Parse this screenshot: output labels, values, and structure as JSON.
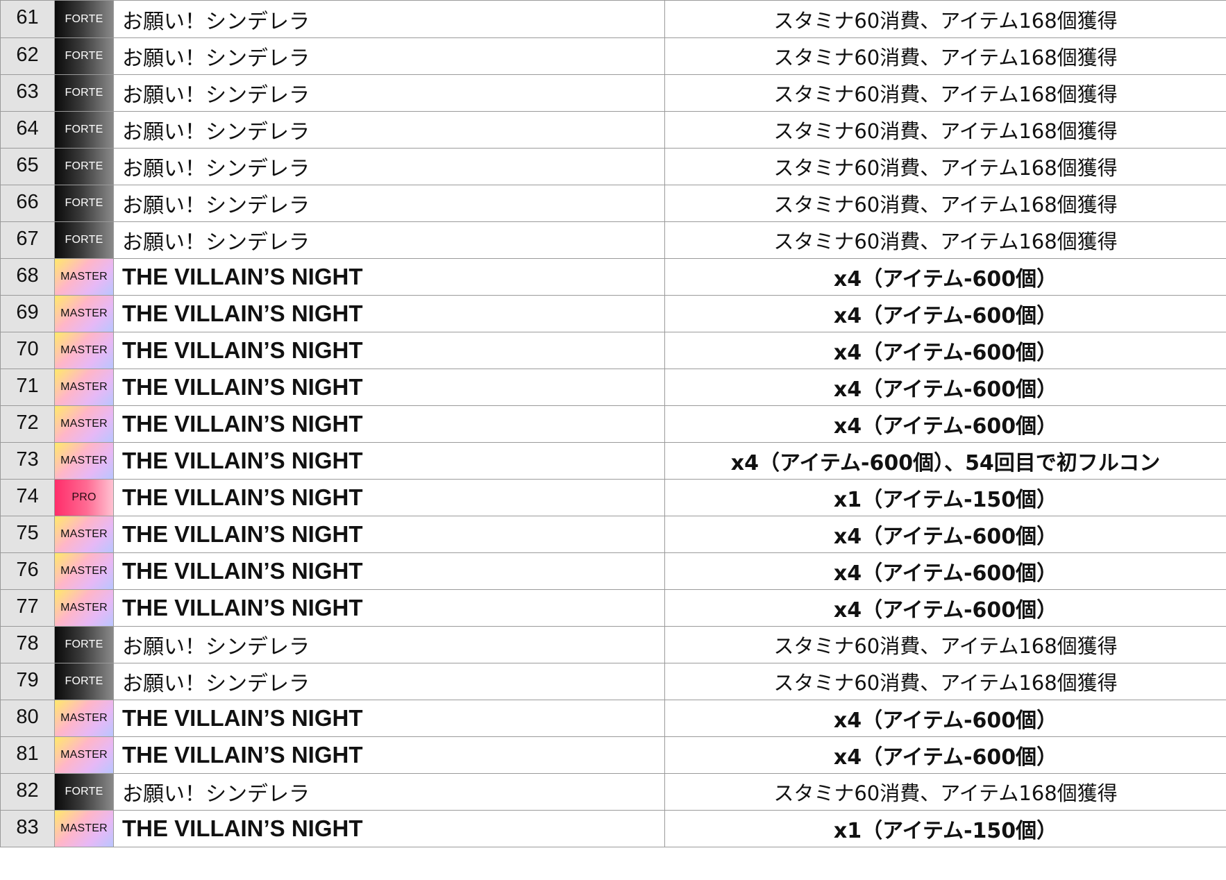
{
  "table": {
    "rows": [
      {
        "no": "61",
        "diff": "FORTE",
        "song": "お願い！シンデレラ",
        "note": "スタミナ60消費、アイテム168個獲得"
      },
      {
        "no": "62",
        "diff": "FORTE",
        "song": "お願い！シンデレラ",
        "note": "スタミナ60消費、アイテム168個獲得"
      },
      {
        "no": "63",
        "diff": "FORTE",
        "song": "お願い！シンデレラ",
        "note": "スタミナ60消費、アイテム168個獲得"
      },
      {
        "no": "64",
        "diff": "FORTE",
        "song": "お願い！シンデレラ",
        "note": "スタミナ60消費、アイテム168個獲得"
      },
      {
        "no": "65",
        "diff": "FORTE",
        "song": "お願い！シンデレラ",
        "note": "スタミナ60消費、アイテム168個獲得"
      },
      {
        "no": "66",
        "diff": "FORTE",
        "song": "お願い！シンデレラ",
        "note": "スタミナ60消費、アイテム168個獲得"
      },
      {
        "no": "67",
        "diff": "FORTE",
        "song": "お願い！シンデレラ",
        "note": "スタミナ60消費、アイテム168個獲得"
      },
      {
        "no": "68",
        "diff": "MASTER",
        "song": "THE VILLAIN’S NIGHT",
        "note": "x4（アイテム-600個）"
      },
      {
        "no": "69",
        "diff": "MASTER",
        "song": "THE VILLAIN’S NIGHT",
        "note": "x4（アイテム-600個）"
      },
      {
        "no": "70",
        "diff": "MASTER",
        "song": "THE VILLAIN’S NIGHT",
        "note": "x4（アイテム-600個）"
      },
      {
        "no": "71",
        "diff": "MASTER",
        "song": "THE VILLAIN’S NIGHT",
        "note": "x4（アイテム-600個）"
      },
      {
        "no": "72",
        "diff": "MASTER",
        "song": "THE VILLAIN’S NIGHT",
        "note": "x4（アイテム-600個）"
      },
      {
        "no": "73",
        "diff": "MASTER",
        "song": "THE VILLAIN’S NIGHT",
        "note": "x4（アイテム-600個）、54回目で初フルコン"
      },
      {
        "no": "74",
        "diff": "PRO",
        "song": "THE VILLAIN’S NIGHT",
        "note": "x1（アイテム-150個）"
      },
      {
        "no": "75",
        "diff": "MASTER",
        "song": "THE VILLAIN’S NIGHT",
        "note": "x4（アイテム-600個）"
      },
      {
        "no": "76",
        "diff": "MASTER",
        "song": "THE VILLAIN’S NIGHT",
        "note": "x4（アイテム-600個）"
      },
      {
        "no": "77",
        "diff": "MASTER",
        "song": "THE VILLAIN’S NIGHT",
        "note": "x4（アイテム-600個）"
      },
      {
        "no": "78",
        "diff": "FORTE",
        "song": "お願い！シンデレラ",
        "note": "スタミナ60消費、アイテム168個獲得"
      },
      {
        "no": "79",
        "diff": "FORTE",
        "song": "お願い！シンデレラ",
        "note": "スタミナ60消費、アイテム168個獲得"
      },
      {
        "no": "80",
        "diff": "MASTER",
        "song": "THE VILLAIN’S NIGHT",
        "note": "x4（アイテム-600個）"
      },
      {
        "no": "81",
        "diff": "MASTER",
        "song": "THE VILLAIN’S NIGHT",
        "note": "x4（アイテム-600個）"
      },
      {
        "no": "82",
        "diff": "FORTE",
        "song": "お願い！シンデレラ",
        "note": "スタミナ60消費、アイテム168個獲得"
      },
      {
        "no": "83",
        "diff": "MASTER",
        "song": "THE VILLAIN’S NIGHT",
        "note": "x1（アイテム-150個）"
      }
    ]
  },
  "colors": {
    "number_cell_bg": "#e3e3e3",
    "grid_line": "#9a9a9a",
    "forte_badge": "#0a0a0a",
    "master_badge": "#ffb6c8",
    "pro_badge": "#ff2d6a"
  }
}
